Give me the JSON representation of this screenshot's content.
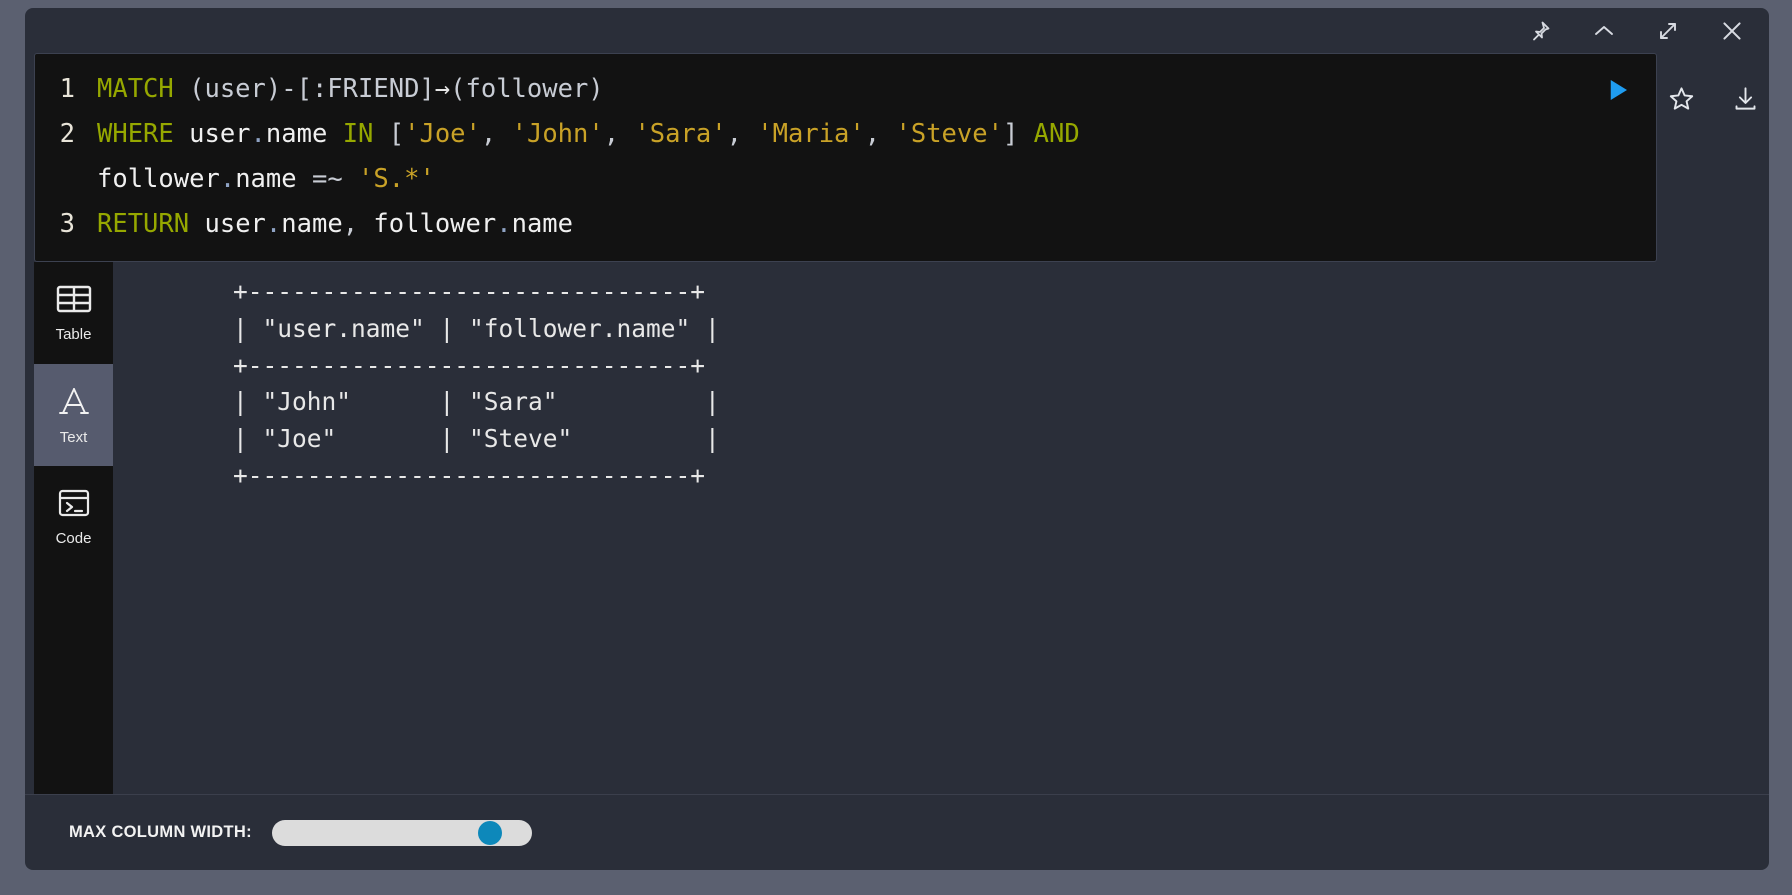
{
  "titlebar": {
    "buttons": [
      {
        "name": "pin-icon",
        "label": "Pin"
      },
      {
        "name": "chevron-up-icon",
        "label": "Collapse"
      },
      {
        "name": "expand-icon",
        "label": "Expand"
      },
      {
        "name": "close-icon",
        "label": "Close"
      }
    ]
  },
  "editor": {
    "lines": [
      {
        "number": "1"
      },
      {
        "number": "2"
      },
      {
        "number": ""
      },
      {
        "number": "3"
      }
    ],
    "query_text": "MATCH (user)-[:FRIEND]→(follower)\nWHERE user.name IN ['Joe', 'John', 'Sara', 'Maria', 'Steve'] AND\nfollower.name =~ 'S.*'\nRETURN user.name, follower.name",
    "tokens": {
      "match": "MATCH",
      "user_paren": "(user)",
      "rel": "-[:FRIEND]",
      "arrow": "→",
      "follower_paren": "(follower)",
      "where": "WHERE",
      "user_name": "user",
      "dot": ".",
      "name": "name",
      "in": "IN",
      "bracket_open": "[",
      "s_joe": "'Joe'",
      "s_john": "'John'",
      "s_sara": "'Sara'",
      "s_maria": "'Maria'",
      "s_steve": "'Steve'",
      "bracket_close": "]",
      "and": "AND",
      "follower_ident": "follower",
      "regex_op": "=~",
      "s_regex": "'S.*'",
      "return": "RETURN",
      "comma": ","
    },
    "actions": [
      {
        "name": "run-button",
        "label": "Run query"
      },
      {
        "name": "star-icon",
        "label": "Favorite"
      },
      {
        "name": "download-icon",
        "label": "Download"
      }
    ]
  },
  "view_tabs": [
    {
      "name": "tab-table",
      "label": "Table",
      "icon": "table-icon",
      "active": false
    },
    {
      "name": "tab-text",
      "label": "Text",
      "icon": "text-a-icon",
      "active": true
    },
    {
      "name": "tab-code",
      "label": "Code",
      "icon": "terminal-icon",
      "active": false
    }
  ],
  "result": {
    "columns": [
      "\"user.name\"",
      "\"follower.name\""
    ],
    "rows": [
      [
        "\"John\"",
        "\"Sara\""
      ],
      [
        "\"Joe\"",
        "\"Steve\""
      ]
    ],
    "ascii_table": "+------------------------------+\n| \"user.name\" | \"follower.name\" |\n+------------------------------+\n| \"John\"      | \"Sara\"          |\n| \"Joe\"       | \"Steve\"         |\n+------------------------------+"
  },
  "footer": {
    "slider_label": "MAX COLUMN WIDTH:",
    "slider_percent": 88
  },
  "colors": {
    "page_background": "#5b6070",
    "frame_background": "#2a2e39",
    "editor_background": "#121212",
    "keyword": "#96a800",
    "string": "#c9a227",
    "accent_run": "#1f9cf0",
    "slider_thumb": "#0d88ba",
    "active_tab": "#565b6e"
  }
}
